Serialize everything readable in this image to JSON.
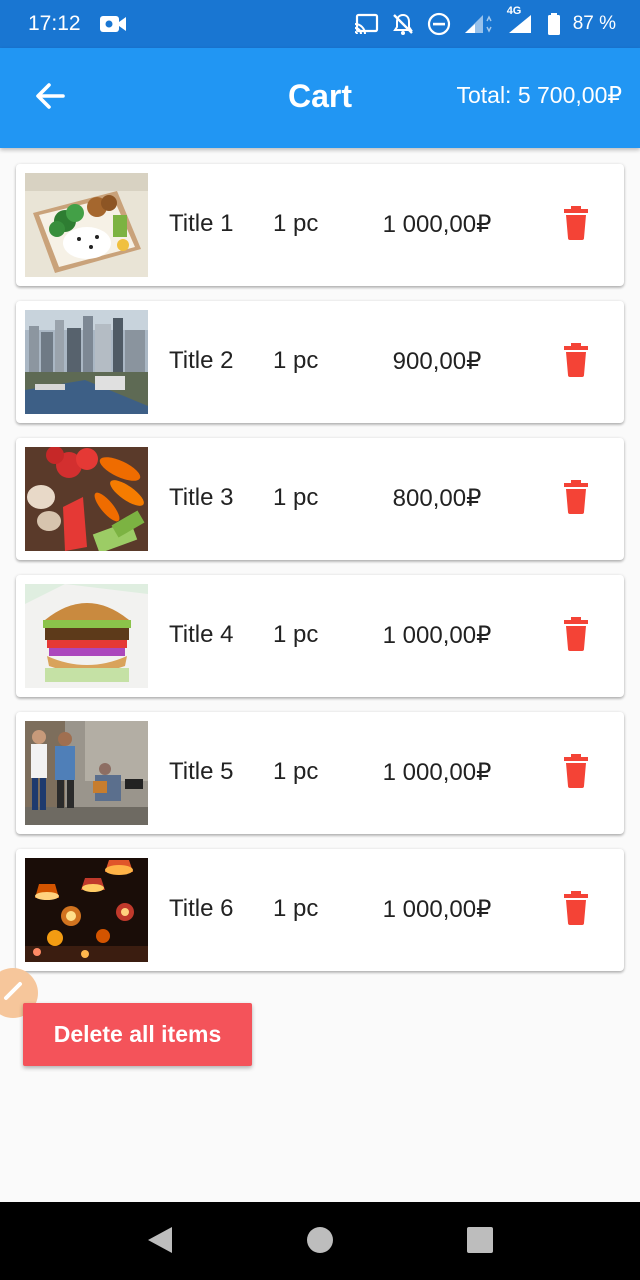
{
  "status_bar": {
    "time": "17:12",
    "icons": [
      "video-camera-icon",
      "cast-icon",
      "bell-off-icon",
      "do-not-disturb-icon",
      "signal-icon",
      "network-4g-icon",
      "battery-icon"
    ],
    "network_label": "4G",
    "battery": "87 %"
  },
  "app_bar": {
    "back_icon": "arrow-back-icon",
    "title": "Cart",
    "total": "Total: 5 700,00₽",
    "color": "#2196f3"
  },
  "items": [
    {
      "title": "Title 1",
      "qty": "1 pc",
      "price": "1 000,00₽",
      "image": "bento-lunch-box"
    },
    {
      "title": "Title 2",
      "qty": "1 pc",
      "price": "900,00₽",
      "image": "city-skyline"
    },
    {
      "title": "Title 3",
      "qty": "1 pc",
      "price": "800,00₽",
      "image": "vegetables"
    },
    {
      "title": "Title 4",
      "qty": "1 pc",
      "price": "1 000,00₽",
      "image": "burger"
    },
    {
      "title": "Title 5",
      "qty": "1 pc",
      "price": "1 000,00₽",
      "image": "street-people"
    },
    {
      "title": "Title 6",
      "qty": "1 pc",
      "price": "1 000,00₽",
      "image": "lanterns-night"
    }
  ],
  "delete_icon": "trash-icon",
  "delete_color": "#f44336",
  "delete_all_label": "Delete all items",
  "delete_all_color": "#f4535a",
  "nav_bar": {
    "icons": [
      "back-triangle-icon",
      "home-circle-icon",
      "recents-square-icon"
    ]
  }
}
